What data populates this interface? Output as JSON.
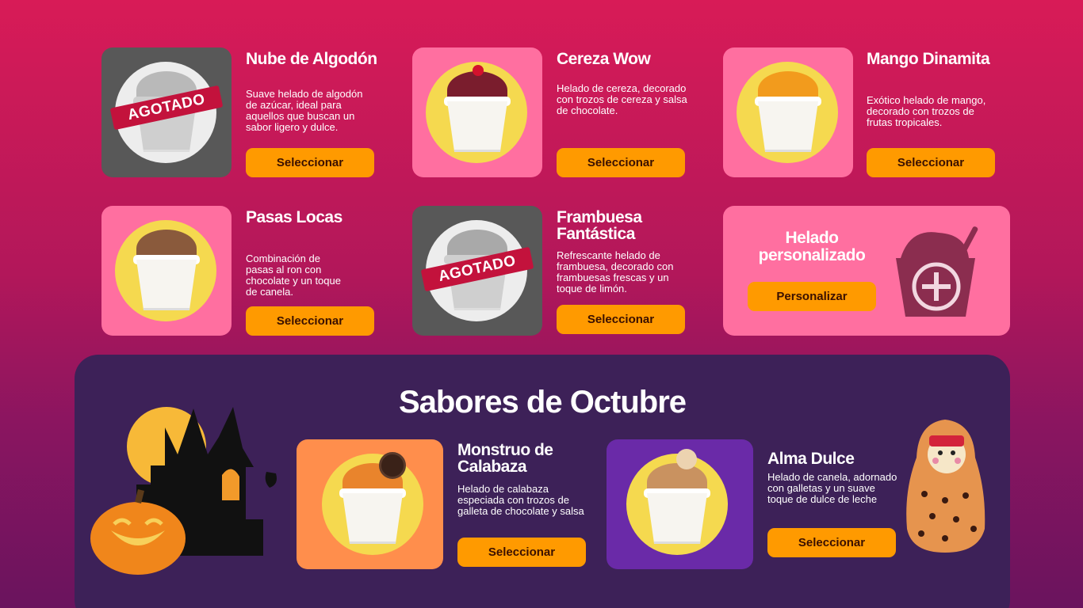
{
  "products": [
    {
      "title": "Nube de Algodón",
      "desc": "Suave helado de algodón de azúcar, ideal para aquellos que buscan un sabor ligero y dulce.",
      "button": "Seleccionar",
      "badge": "AGOTADO"
    },
    {
      "title": "Cereza Wow",
      "desc": "Helado de cereza, decorado con trozos de cereza y salsa de chocolate.",
      "button": "Seleccionar"
    },
    {
      "title": "Mango Dinamita",
      "desc": "Exótico helado de mango, decorado con trozos de frutas tropicales.",
      "button": "Seleccionar"
    },
    {
      "title": "Pasas Locas",
      "desc": "Combinación de pasas al ron con chocolate y un toque de canela.",
      "button": "Seleccionar"
    },
    {
      "title": "Frambuesa Fantástica",
      "desc": "Refrescante helado de frambuesa, decorado con frambuesas frescas y un toque de limón.",
      "button": "Seleccionar",
      "badge": "AGOTADO"
    }
  ],
  "custom": {
    "title": "Helado personalizado",
    "button": "Personalizar"
  },
  "october": {
    "title": "Sabores de Octubre",
    "items": [
      {
        "title": "Monstruo de Calabaza",
        "desc": "Helado de calabaza especiada con trozos de galleta de chocolate y salsa",
        "button": "Seleccionar"
      },
      {
        "title": "Alma Dulce",
        "desc": "Helado de canela, adornado con galletas y un suave toque de dulce de leche",
        "button": "Seleccionar"
      }
    ]
  },
  "colors": {
    "accent": "#ff9a00",
    "card_pink": "#ff6fa0",
    "sold_out": "#c3123c",
    "panel": "#3d2158"
  }
}
